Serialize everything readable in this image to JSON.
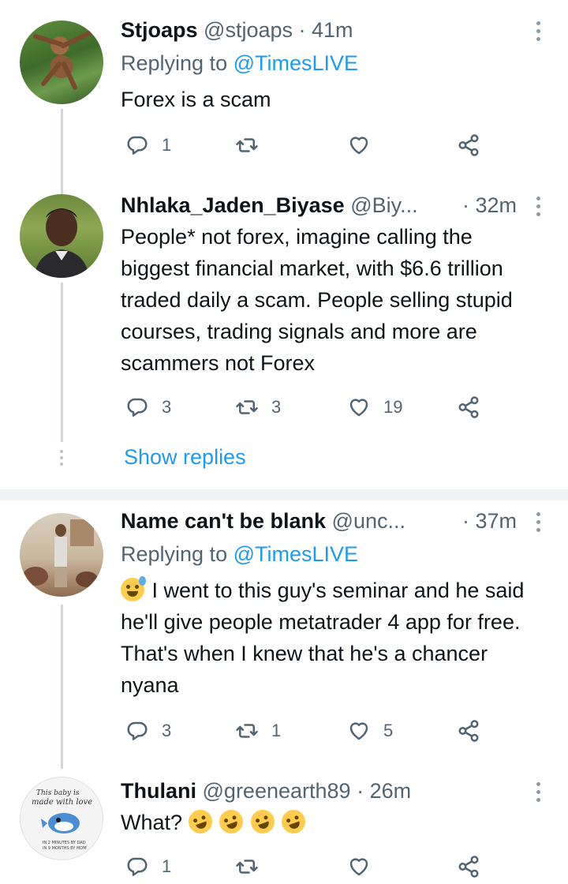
{
  "tweets": [
    {
      "name": "Stjoaps",
      "handle": "@stjoaps",
      "time": "· 41m",
      "replying_label": "Replying to ",
      "replying_to": "@TimesLIVE",
      "text": "Forex is a scam",
      "replies": "1",
      "retweets": "",
      "likes": ""
    },
    {
      "name": "Nhlaka_Jaden_Biyase",
      "handle": "@Biy...",
      "time": "· 32m",
      "text": "People* not forex, imagine calling the biggest financial market, with $6.6 trillion traded daily a scam. People selling stupid courses, trading signals and more are scammers not Forex",
      "replies": "3",
      "retweets": "3",
      "likes": "19"
    },
    {
      "name": "Name can't be blank",
      "handle": "@unc...",
      "time": "· 37m",
      "replying_label": "Replying to ",
      "replying_to": "@TimesLIVE",
      "text": " I went to this guy's seminar and he said he'll give people metatrader 4 app for free. That's when I knew that he's a chancer nyana",
      "emoji": "sweat-smile-emoji",
      "replies": "3",
      "retweets": "1",
      "likes": "5"
    },
    {
      "name": "Thulani",
      "handle": "@greenearth89",
      "time": "· 26m",
      "text": "What?",
      "emoji": "rofl-emoji",
      "emoji_count": 4,
      "replies": "1",
      "retweets": "",
      "likes": ""
    }
  ],
  "show_replies": "Show replies",
  "avatar_text": {
    "line1": "This baby is",
    "line2": "made with love",
    "line3": "IN 2 MINUTES BY DAD",
    "line4": "IN 9 MONTHS BY MOM"
  },
  "icons": {
    "reply": "reply-icon",
    "retweet": "retweet-icon",
    "like": "heart-icon",
    "share": "share-icon",
    "more": "more-vertical-icon"
  },
  "colors": {
    "link": "#1d9bf0",
    "secondary_text": "#536471",
    "thread_line": "#cfd9de"
  }
}
